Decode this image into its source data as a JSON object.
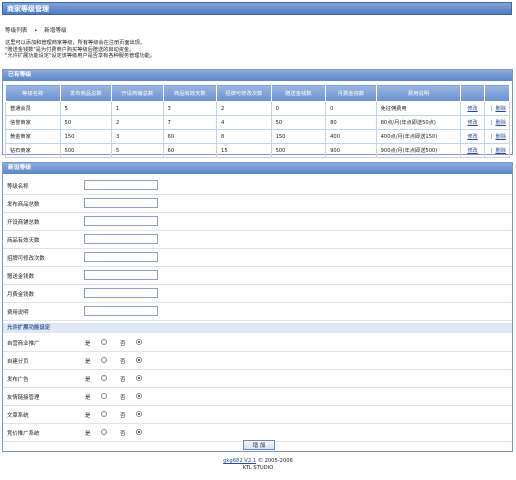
{
  "title": "商家等级管理",
  "breadcrumb": [
    "等级列表",
    "新增等级"
  ],
  "description": [
    "这里可以添加和管理商家等级，所有等级会在注册页面出现。",
    "\"赠送金钱数\"是为付费商户购买等级后赠送的启动资金。",
    "\"允许扩展功能设定\"设定该等级用户是否享有各种服务管理功能。"
  ],
  "list_panel": {
    "header": "已有等级",
    "columns": [
      "等级名称",
      "发布商品总数",
      "开设商铺总数",
      "商品有效天数",
      "招牌可修改次数",
      "赠送金钱数",
      "月费金钱数",
      "费用说明",
      "",
      ""
    ],
    "rows": [
      {
        "name": "普通会员",
        "c1": "5",
        "c2": "1",
        "c3": "3",
        "c4": "2",
        "c5": "0",
        "c6": "0",
        "fee": "免征佣费用"
      },
      {
        "name": "信誉商家",
        "c1": "50",
        "c2": "2",
        "c3": "7",
        "c4": "4",
        "c5": "50",
        "c6": "80",
        "fee": "80点/月(年点即送50点)"
      },
      {
        "name": "黄金商家",
        "c1": "150",
        "c2": "3",
        "c3": "60",
        "c4": "8",
        "c5": "150",
        "c6": "400",
        "fee": "400点/月(年点即送150)"
      },
      {
        "name": "钻石商家",
        "c1": "500",
        "c2": "5",
        "c3": "60",
        "c4": "15",
        "c5": "500",
        "c6": "900",
        "fee": "900点/月(年点即送500)"
      }
    ],
    "edit_label": "修改",
    "delete_label": "删除",
    "sep": "|"
  },
  "form_panel": {
    "header": "新设等级",
    "fields": [
      "等级名称",
      "发布商品总数",
      "开设商铺总数",
      "商品有效天数",
      "招牌可修改次数",
      "赠送金钱数",
      "月费金钱数",
      "费用说明"
    ],
    "ext_header": "允许扩展功能设定",
    "options": [
      "自营商业推广",
      "自建分页",
      "发布广告",
      "友情链接管理",
      "文章系统",
      "竞价推广系统"
    ],
    "yes_label": "是",
    "no_label": "否",
    "submit": "增 加"
  },
  "footer": {
    "line1_link": "gkg682 V2.1",
    "line1_text": "© 2005-2006",
    "line2": "KTL STUDIO"
  }
}
